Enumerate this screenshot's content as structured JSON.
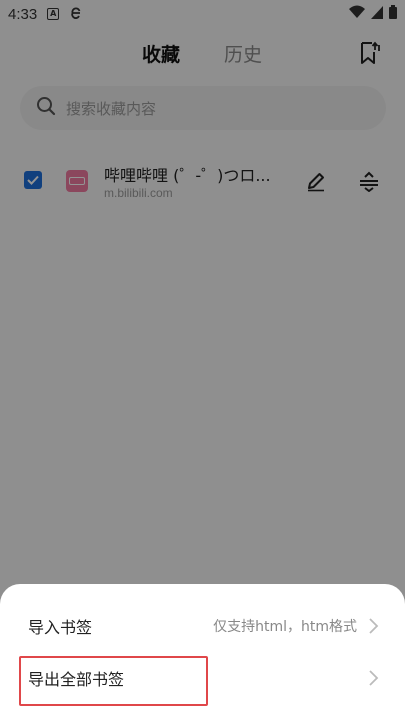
{
  "status_bar": {
    "time": "4:33",
    "icons": [
      "a-box-icon",
      "browser-e-icon",
      "wifi-icon",
      "signal-icon",
      "battery-icon"
    ]
  },
  "header": {
    "tabs": [
      {
        "label": "收藏",
        "active": true
      },
      {
        "label": "历史",
        "active": false
      }
    ],
    "bookmark_icon": "bookmark-sync-icon"
  },
  "search": {
    "placeholder": "搜索收藏内容"
  },
  "bookmarks": [
    {
      "checked": true,
      "title": "哔哩哔哩 (゜-゜)つロ...",
      "url": "m.bilibili.com",
      "icon_color": "#f07aa0"
    }
  ],
  "sheet": {
    "import": {
      "label": "导入书签",
      "hint": "仅支持html，htm格式"
    },
    "export": {
      "label": "导出全部书签"
    }
  },
  "colors": {
    "accent": "#1e6fd9",
    "highlight": "#e0474a"
  }
}
